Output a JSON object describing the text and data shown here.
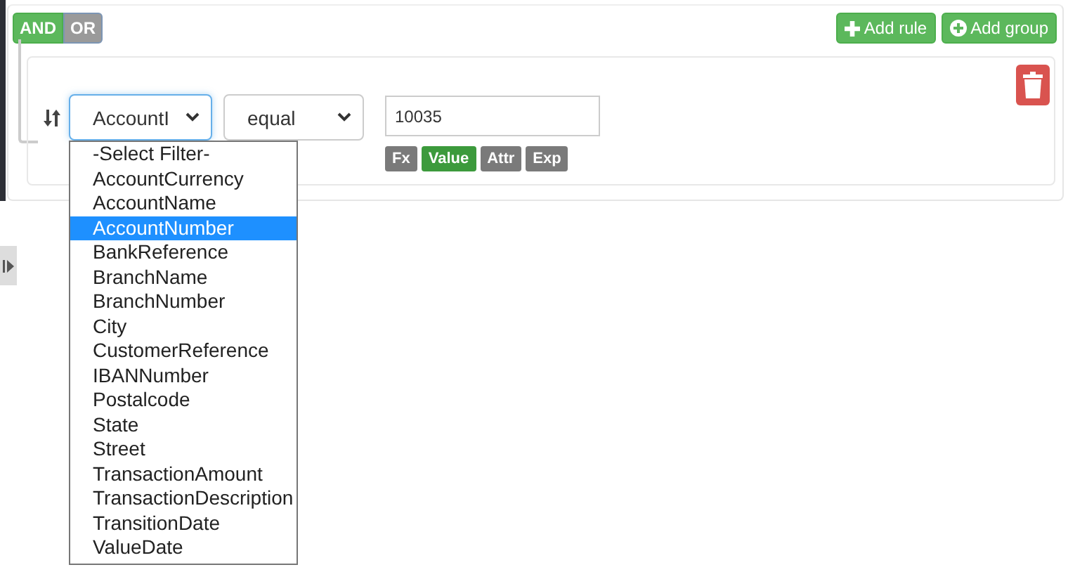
{
  "conditions": [
    {
      "label": "AND",
      "selected": true
    },
    {
      "label": "OR",
      "selected": false
    }
  ],
  "actions": [
    {
      "kind": "plus",
      "label": "Add rule"
    },
    {
      "kind": "circle-plus",
      "label": "Add group"
    }
  ],
  "rule": {
    "field": {
      "value": "AccountI",
      "expanded": true,
      "options": [
        {
          "label": "-Select Filter-",
          "selected": false
        },
        {
          "label": "AccountCurrency",
          "selected": false
        },
        {
          "label": "AccountName",
          "selected": false
        },
        {
          "label": "AccountNumber",
          "selected": true
        },
        {
          "label": "BankReference",
          "selected": false
        },
        {
          "label": "BranchName",
          "selected": false
        },
        {
          "label": "BranchNumber",
          "selected": false
        },
        {
          "label": "City",
          "selected": false
        },
        {
          "label": "CustomerReference",
          "selected": false
        },
        {
          "label": "IBANNumber",
          "selected": false
        },
        {
          "label": "Postalcode",
          "selected": false
        },
        {
          "label": "State",
          "selected": false
        },
        {
          "label": "Street",
          "selected": false
        },
        {
          "label": "TransactionAmount",
          "selected": false
        },
        {
          "label": "TransactionDescription",
          "selected": false
        },
        {
          "label": "TransitionDate",
          "selected": false
        },
        {
          "label": "ValueDate",
          "selected": false
        }
      ]
    },
    "operator": {
      "value": "equal"
    },
    "value": {
      "value": "10035"
    },
    "value_types": [
      {
        "label": "Fx",
        "selected": false
      },
      {
        "label": "Value",
        "selected": true
      },
      {
        "label": "Attr",
        "selected": false
      },
      {
        "label": "Exp",
        "selected": false
      }
    ]
  }
}
